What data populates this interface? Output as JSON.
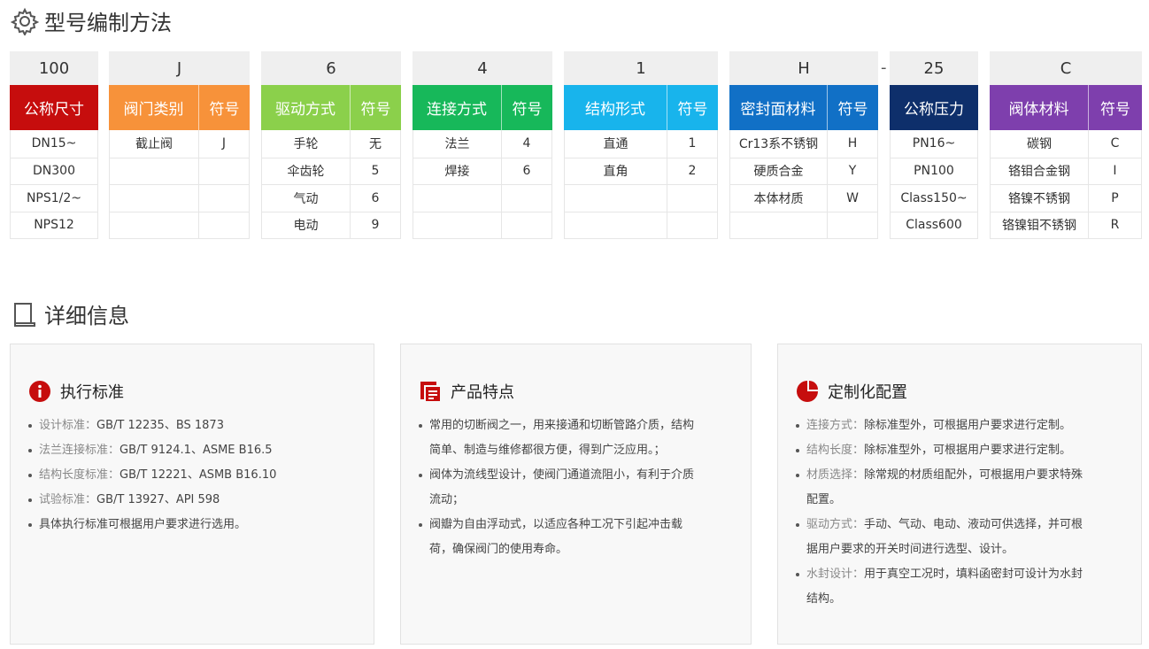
{
  "section1_title": "型号编制方法",
  "section2_title": "详细信息",
  "blocks": [
    {
      "code": "100",
      "headers": [
        {
          "label": "公称尺寸",
          "color": "#c60d0d"
        }
      ],
      "rows": [
        [
          "DN15~"
        ],
        [
          "DN300"
        ],
        [
          "NPS1/2~"
        ],
        [
          "NPS12"
        ]
      ]
    },
    {
      "code": "J",
      "headers": [
        {
          "label": "阀门类别",
          "color": "#f7923a"
        },
        {
          "label": "符号",
          "color": "#f7923a"
        }
      ],
      "rows": [
        [
          "截止阀",
          "J"
        ],
        [
          "",
          ""
        ],
        [
          "",
          ""
        ],
        [
          "",
          ""
        ]
      ]
    },
    {
      "code": "6",
      "headers": [
        {
          "label": "驱动方式",
          "color": "#8bd04b"
        },
        {
          "label": "符号",
          "color": "#8bd04b"
        }
      ],
      "rows": [
        [
          "手轮",
          "无"
        ],
        [
          "伞齿轮",
          "5"
        ],
        [
          "气动",
          "6"
        ],
        [
          "电动",
          "9"
        ]
      ]
    },
    {
      "code": "4",
      "headers": [
        {
          "label": "连接方式",
          "color": "#17b85a"
        },
        {
          "label": "符号",
          "color": "#17b85a"
        }
      ],
      "rows": [
        [
          "法兰",
          "4"
        ],
        [
          "焊接",
          "6"
        ],
        [
          "",
          ""
        ],
        [
          "",
          ""
        ]
      ]
    },
    {
      "code": "1",
      "headers": [
        {
          "label": "结构形式",
          "color": "#18b4ec"
        },
        {
          "label": "符号",
          "color": "#18b4ec"
        }
      ],
      "rows": [
        [
          "直通",
          "1"
        ],
        [
          "直角",
          "2"
        ],
        [
          "",
          ""
        ],
        [
          "",
          ""
        ]
      ]
    },
    {
      "code": "H",
      "headers": [
        {
          "label": "密封面材料",
          "color": "#1170c6"
        },
        {
          "label": "符号",
          "color": "#1170c6"
        }
      ],
      "rows": [
        [
          "Cr13系不锈钢",
          "H"
        ],
        [
          "硬质合金",
          "Y"
        ],
        [
          "本体材质",
          "W"
        ],
        [
          "",
          ""
        ]
      ]
    },
    {
      "code": "25",
      "headers": [
        {
          "label": "公称压力",
          "color": "#0e2f6b"
        }
      ],
      "rows": [
        [
          "PN16~"
        ],
        [
          "PN100"
        ],
        [
          "Class150~"
        ],
        [
          "Class600"
        ]
      ]
    },
    {
      "code": "C",
      "headers": [
        {
          "label": "阀体材料",
          "color": "#7e3fad"
        },
        {
          "label": "符号",
          "color": "#7e3fad"
        }
      ],
      "rows": [
        [
          "碳钢",
          "C"
        ],
        [
          "铬钼合金钢",
          "I"
        ],
        [
          "铬镍不锈钢",
          "P"
        ],
        [
          "铬镍钼不锈钢",
          "R"
        ]
      ]
    }
  ],
  "dash": "-",
  "cards": [
    {
      "title": "执行标准",
      "icon": "info-icon",
      "items": [
        {
          "label": "设计标准：",
          "text": "GB/T 12235、BS 1873"
        },
        {
          "label": "法兰连接标准：",
          "text": "GB/T 9124.1、ASME B16.5"
        },
        {
          "label": "结构长度标准：",
          "text": "GB/T 12221、ASMB B16.10"
        },
        {
          "label": "试验标准：",
          "text": "GB/T 13927、API 598"
        },
        {
          "label": "",
          "text": "具体执行标准可根据用户要求进行选用。"
        }
      ]
    },
    {
      "title": "产品特点",
      "icon": "document-icon",
      "items": [
        {
          "label": "",
          "text": "常用的切断阀之一，用来接通和切断管路介质，结构"
        },
        {
          "label": "",
          "text": "简单、制造与维修都很方便，得到广泛应用。；"
        },
        {
          "label": "",
          "text": "阀体为流线型设计，使阀门通道流阻小，有利于介质"
        },
        {
          "label": "",
          "text": "流动；"
        },
        {
          "label": "",
          "text": "阀瓣为自由浮动式，以适应各种工况下引起冲击载"
        },
        {
          "label": "",
          "text": "荷，确保阀门的使用寿命。"
        }
      ]
    },
    {
      "title": "定制化配置",
      "icon": "pie-chart-icon",
      "items": [
        {
          "label": "连接方式：",
          "text": "除标准型外，可根据用户要求进行定制。"
        },
        {
          "label": "结构长度：",
          "text": "除标准型外，可根据用户要求进行定制。"
        },
        {
          "label": "材质选择：",
          "text": "除常规的材质组配外，可根据用户要求特殊"
        },
        {
          "label": "",
          "text": "配置。"
        },
        {
          "label": "驱动方式：",
          "text": "手动、气动、电动、液动可供选择，并可根"
        },
        {
          "label": "",
          "text": "据用户要求的开关时间进行选型、设计。"
        },
        {
          "label": "水封设计：",
          "text": "用于真空工况时，填料函密封可设计为水封"
        },
        {
          "label": "",
          "text": "结构。"
        }
      ]
    }
  ]
}
